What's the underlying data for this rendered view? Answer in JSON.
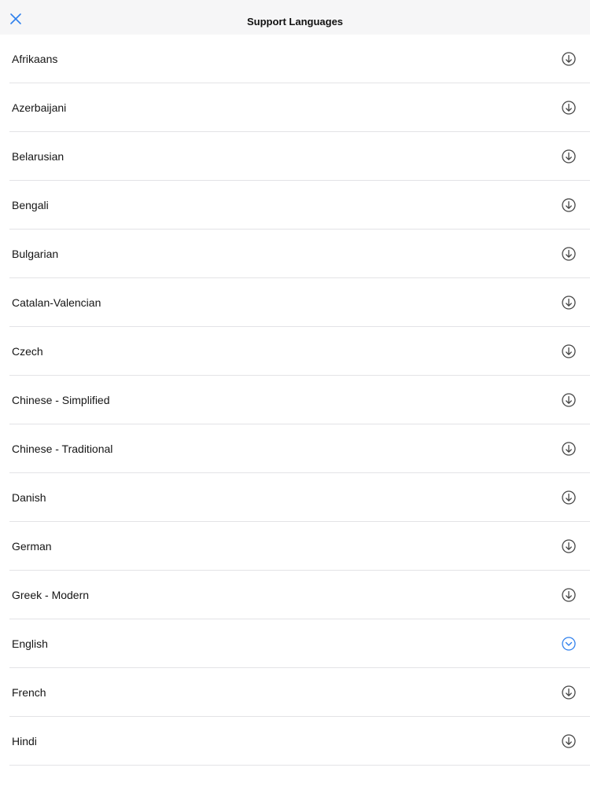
{
  "header": {
    "title": "Support Languages",
    "close_icon": "close-icon",
    "accent_color": "#2f80ed"
  },
  "languages": [
    {
      "label": "Afrikaans",
      "state": "download"
    },
    {
      "label": "Azerbaijani",
      "state": "download"
    },
    {
      "label": "Belarusian",
      "state": "download"
    },
    {
      "label": "Bengali",
      "state": "download"
    },
    {
      "label": "Bulgarian",
      "state": "download"
    },
    {
      "label": "Catalan-Valencian",
      "state": "download"
    },
    {
      "label": "Czech",
      "state": "download"
    },
    {
      "label": "Chinese - Simplified",
      "state": "download"
    },
    {
      "label": "Chinese - Traditional",
      "state": "download"
    },
    {
      "label": "Danish",
      "state": "download"
    },
    {
      "label": "German",
      "state": "download"
    },
    {
      "label": "Greek - Modern",
      "state": "download"
    },
    {
      "label": "English",
      "state": "downloaded"
    },
    {
      "label": "French",
      "state": "download"
    },
    {
      "label": "Hindi",
      "state": "download"
    }
  ],
  "icons": {
    "download": "download-circle-icon",
    "downloaded": "downloaded-check-icon"
  }
}
